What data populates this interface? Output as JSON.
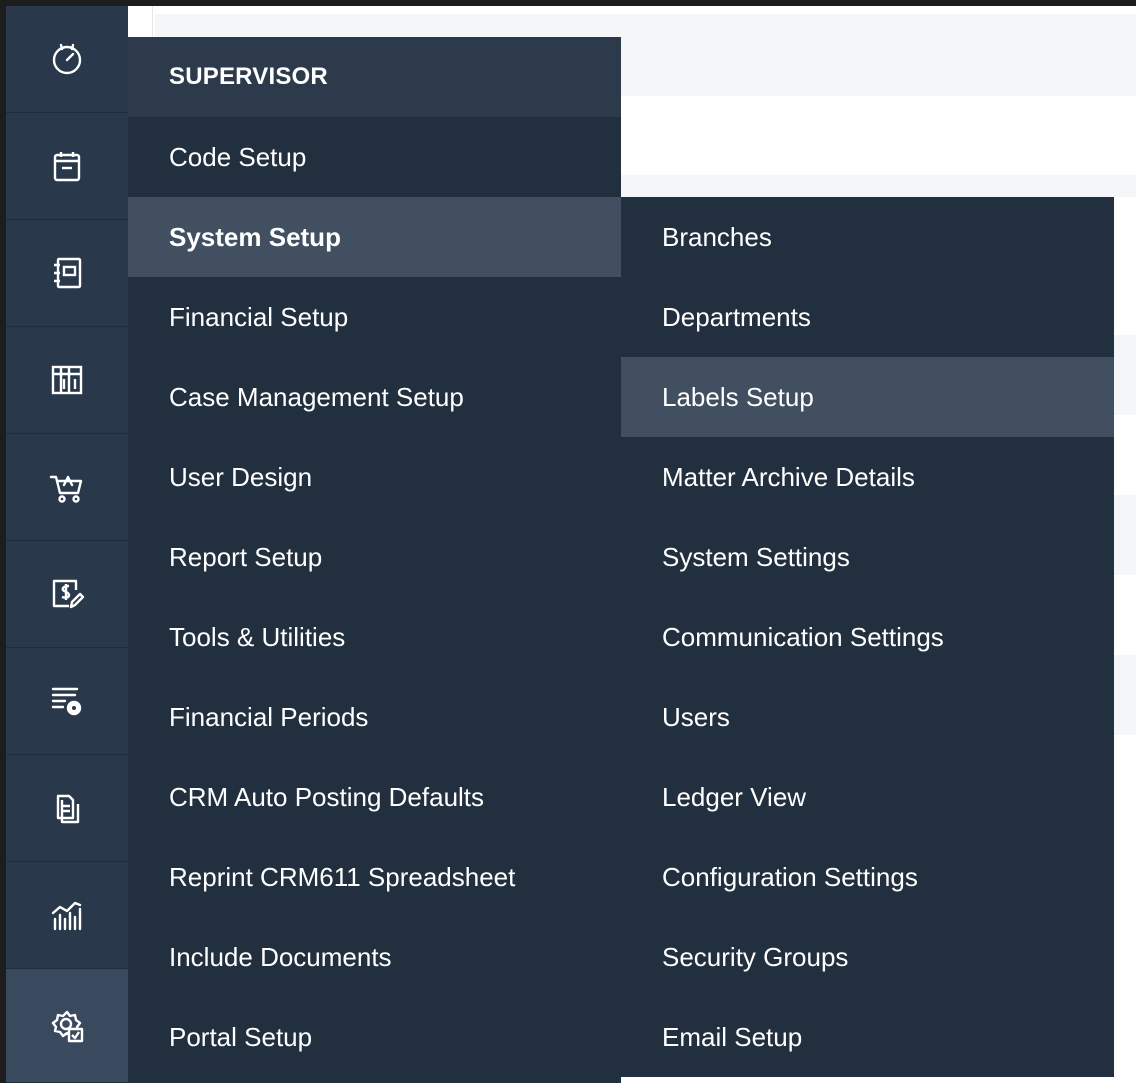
{
  "rail": {
    "icons": [
      {
        "name": "clock-icon"
      },
      {
        "name": "calendar-icon"
      },
      {
        "name": "contact-book-icon"
      },
      {
        "name": "library-icon"
      },
      {
        "name": "cart-icon"
      },
      {
        "name": "billing-icon"
      },
      {
        "name": "list-settings-icon"
      },
      {
        "name": "documents-icon"
      },
      {
        "name": "analytics-icon"
      },
      {
        "name": "supervisor-settings-icon"
      }
    ],
    "active_index": 9
  },
  "menu": {
    "header": "SUPERVISOR",
    "items": [
      "Code Setup",
      "System Setup",
      "Financial Setup",
      "Case Management Setup",
      "User Design",
      "Report Setup",
      "Tools & Utilities",
      "Financial Periods",
      "CRM Auto Posting Defaults",
      "Reprint CRM611 Spreadsheet",
      "Include Documents",
      "Portal Setup"
    ],
    "active_item": "System Setup"
  },
  "submenu": {
    "items": [
      "Branches",
      "Departments",
      "Labels Setup",
      "Matter Archive Details",
      "System Settings",
      "Communication Settings",
      "Users",
      "Ledger View",
      "Configuration Settings",
      "Security Groups",
      "Email Setup"
    ],
    "hovered_item": "Labels Setup"
  },
  "colors": {
    "rail_bg": "#29394b",
    "menu_bg": "#222f3e",
    "menu_header_bg": "#2d3a4c",
    "active_bg": "#414f61",
    "text": "#ffffff"
  }
}
